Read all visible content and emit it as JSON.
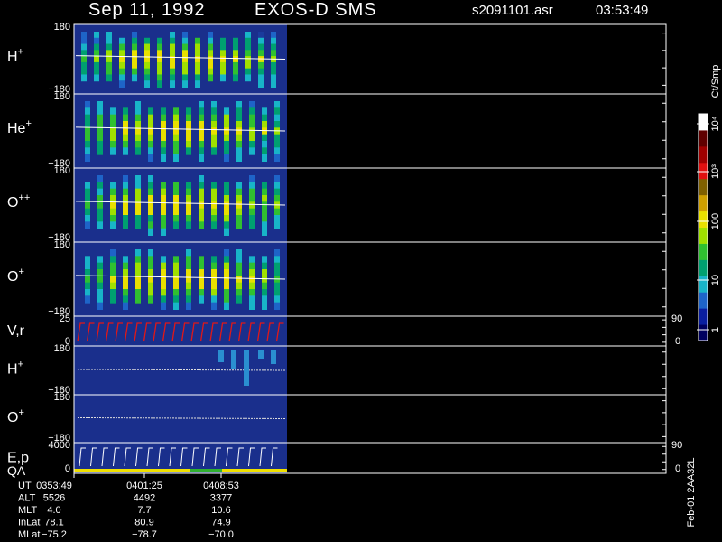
{
  "header": {
    "date": "Sep 11, 1992",
    "instrument": "EXOS-D SMS",
    "file": "s2091101.asr",
    "time": "03:53:49"
  },
  "colors": {
    "background": "#000000",
    "panel_fill": "#1a2f8c",
    "frame": "#ffffff",
    "trace_red": "#e01818",
    "qa_yellow": "#f0e000",
    "qa_green": "#30b030"
  },
  "colorbar": {
    "unit": "Ct/Smp",
    "ticks": [
      "1",
      "10",
      "100",
      "10³",
      "10⁴"
    ],
    "stops": [
      "#000060",
      "#0a1ea0",
      "#1e64c8",
      "#18b4c8",
      "#00a070",
      "#30c030",
      "#a0e000",
      "#e8e000",
      "#d0a000",
      "#806000",
      "#e01010",
      "#a00000",
      "#600000",
      "#ffffff"
    ]
  },
  "chart_data": {
    "type": "heatmap",
    "panels": [
      {
        "label": "H",
        "sup": "+",
        "ytop": "180",
        "ybottom": "−180",
        "ylim": [
          -180,
          180
        ]
      },
      {
        "label": "He",
        "sup": "+",
        "ytop": "180",
        "ybottom": "−180",
        "ylim": [
          -180,
          180
        ]
      },
      {
        "label": "O",
        "sup": "++",
        "ytop": "180",
        "ybottom": "−180",
        "ylim": [
          -180,
          180
        ]
      },
      {
        "label": "O",
        "sup": "+",
        "ytop": "180",
        "ybottom": "−180",
        "ylim": [
          -180,
          180
        ]
      },
      {
        "label": "V,r",
        "sup": "",
        "ytop": "25",
        "ybottom": "0",
        "ylim": [
          0,
          25
        ],
        "right_top": "90",
        "right_bottom": "0"
      },
      {
        "label": "H",
        "sup": "+",
        "ytop": "180",
        "ybottom": "−180",
        "ylim": [
          -180,
          180
        ]
      },
      {
        "label": "O",
        "sup": "+",
        "ytop": "180",
        "ybottom": "−180",
        "ylim": [
          -180,
          180
        ]
      },
      {
        "label": "E,p",
        "label2": "QA",
        "sup": "",
        "ytop": "4000",
        "ybottom": "0",
        "ylim": [
          0,
          4000
        ],
        "right_top": "90",
        "right_bottom": "0"
      }
    ],
    "time_axis": {
      "ticks": [
        "0353:49",
        "0401:25",
        "0408:53"
      ],
      "rows": [
        {
          "name": "UT",
          "values": [
            "0353:49",
            "0401:25",
            "0408:53"
          ]
        },
        {
          "name": "ALT",
          "values": [
            "5526",
            "4492",
            "3377"
          ]
        },
        {
          "name": "MLT",
          "values": [
            "4.0",
            "7.7",
            "10.6"
          ]
        },
        {
          "name": "InLat",
          "values": [
            "78.1",
            "80.9",
            "74.9"
          ]
        },
        {
          "name": "MLat",
          "values": [
            "−75.2",
            "−78.7",
            "−70.0"
          ]
        }
      ]
    }
  },
  "footer_right": "Feb-01 2AA32L"
}
